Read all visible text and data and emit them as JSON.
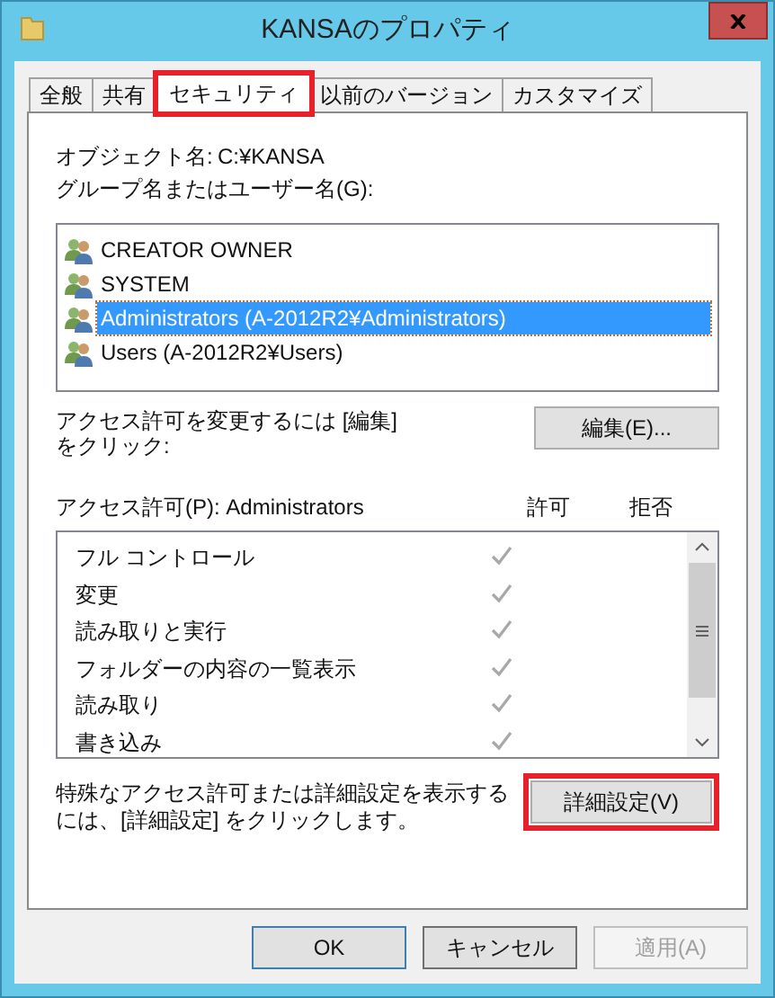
{
  "window": {
    "title": "KANSAのプロパティ"
  },
  "tabs": [
    {
      "label": "全般",
      "selected": false,
      "highlighted": false
    },
    {
      "label": "共有",
      "selected": false,
      "highlighted": false
    },
    {
      "label": "セキュリティ",
      "selected": true,
      "highlighted": true
    },
    {
      "label": "以前のバージョン",
      "selected": false,
      "highlighted": false
    },
    {
      "label": "カスタマイズ",
      "selected": false,
      "highlighted": false
    }
  ],
  "object_name": {
    "label": "オブジェクト名:",
    "value": "C:¥KANSA"
  },
  "groups": {
    "label": "グループ名またはユーザー名(G):",
    "items": [
      {
        "name": "CREATOR OWNER",
        "selected": false
      },
      {
        "name": "SYSTEM",
        "selected": false
      },
      {
        "name": "Administrators (A-2012R2¥Administrators)",
        "selected": true
      },
      {
        "name": "Users (A-2012R2¥Users)",
        "selected": false
      }
    ]
  },
  "edit_hint": "アクセス許可を変更するには [編集]\nをクリック:",
  "edit_button": {
    "label": "編集(E)..."
  },
  "permissions": {
    "label": "アクセス許可(P): Administrators",
    "allow_header": "許可",
    "deny_header": "拒否",
    "rows": [
      {
        "name": "フル コントロール",
        "allow": true,
        "deny": false
      },
      {
        "name": "変更",
        "allow": true,
        "deny": false
      },
      {
        "name": "読み取りと実行",
        "allow": true,
        "deny": false
      },
      {
        "name": "フォルダーの内容の一覧表示",
        "allow": true,
        "deny": false
      },
      {
        "name": "読み取り",
        "allow": true,
        "deny": false
      },
      {
        "name": "書き込み",
        "allow": true,
        "deny": false
      }
    ]
  },
  "advanced_hint": "特殊なアクセス許可または詳細設定を表示するには、[詳細設定] をクリックします。",
  "advanced_button": {
    "label": "詳細設定(V)",
    "highlighted": true
  },
  "dialog_buttons": [
    {
      "label": "OK",
      "default": true,
      "disabled": false
    },
    {
      "label": "キャンセル",
      "default": false,
      "disabled": false
    },
    {
      "label": "適用(A)",
      "default": false,
      "disabled": true
    }
  ]
}
